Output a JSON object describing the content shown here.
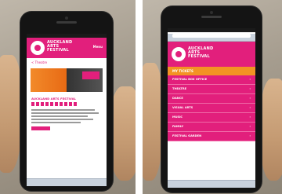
{
  "left_phone": {
    "brand_lines": [
      "AUCKLAND",
      "ARTS",
      "FESTIVAL"
    ],
    "menu_label": "Menu",
    "back_link": "< Theatre",
    "section_heading": "AUCKLAND ARTS FESTIVAL"
  },
  "right_phone": {
    "brand_lines": [
      "AUCKLAND",
      "ARTS",
      "FESTIVAL"
    ],
    "highlight_item": "MY TICKETS",
    "nav_items": [
      "FESTIVAL BOX OFFICE",
      "THEATRE",
      "DANCE",
      "VISUAL ARTS",
      "MUSIC",
      "FAMILY",
      "FESTIVAL GARDEN"
    ],
    "chevron": "›"
  },
  "colors": {
    "brand_pink": "#e21f7c",
    "highlight_orange": "#f39323",
    "device_black": "#141414"
  }
}
